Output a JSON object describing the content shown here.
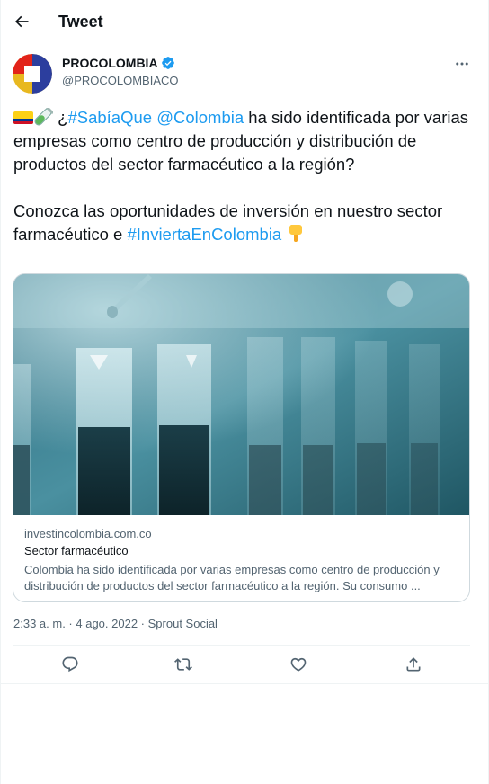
{
  "header": {
    "title": "Tweet",
    "back_icon": "arrow-left-icon"
  },
  "author": {
    "name": "PROCOLOMBIA",
    "handle": "@PROCOLOMBIACO",
    "verified": true,
    "verified_color": "#1d9bf0"
  },
  "tweet": {
    "line1_prefix": "¿",
    "hashtag1": "#SabíaQue",
    "mention": "@Colombia",
    "line1_rest": " ha sido identificada por varias empresas como centro de producción y distribución de productos del sector farmacéutico a la región?",
    "para2_text": "Conozca las oportunidades de inversión en nuestro sector farmacéutico e ",
    "hashtag2": "#InviertaEnColombia",
    "emojis": [
      "colombia-flag",
      "test-tube",
      "pointing-down-hand"
    ]
  },
  "card": {
    "domain": "investincolombia.com.co",
    "title": "Sector farmacéutico",
    "description": "Colombia ha sido identificada por varias empresas como centro de producción y distribución de productos del sector farmacéutico a la región. Su consumo ..."
  },
  "meta": {
    "time": "2:33 a. m.",
    "sep1": " · ",
    "date": "4 ago. 2022",
    "sep2": " · ",
    "source": "Sprout Social"
  },
  "actions": [
    "reply-icon",
    "retweet-icon",
    "like-icon",
    "share-icon"
  ],
  "colors": {
    "link": "#1d9bf0",
    "muted": "#536471",
    "text": "#0f1419",
    "border": "#cfd9de"
  }
}
